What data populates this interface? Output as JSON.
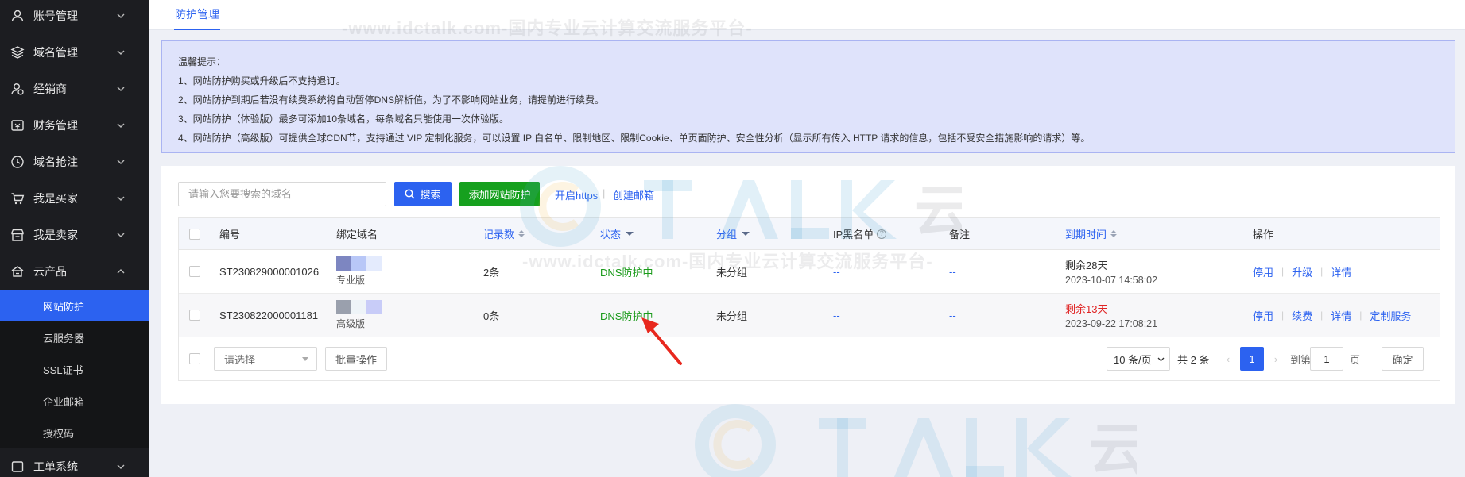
{
  "sidebar": {
    "items": [
      {
        "label": "账号管理",
        "icon": "user-icon"
      },
      {
        "label": "域名管理",
        "icon": "layers-icon"
      },
      {
        "label": "经销商",
        "icon": "dealer-icon"
      },
      {
        "label": "财务管理",
        "icon": "finance-icon"
      },
      {
        "label": "域名抢注",
        "icon": "clock-icon"
      },
      {
        "label": "我是买家",
        "icon": "cart-icon"
      },
      {
        "label": "我是卖家",
        "icon": "store-icon"
      },
      {
        "label": "云产品",
        "icon": "cloud-icon"
      }
    ],
    "sub_items": [
      {
        "label": "网站防护",
        "active": true
      },
      {
        "label": "云服务器"
      },
      {
        "label": "SSL证书"
      },
      {
        "label": "企业邮箱"
      },
      {
        "label": "授权码"
      }
    ],
    "last_item": {
      "label": "工单系统",
      "icon": "ticket-icon"
    }
  },
  "topbar": {
    "tab_label": "防护管理"
  },
  "notice": {
    "title": "温馨提示：",
    "lines": [
      "1、网站防护购买或升级后不支持退订。",
      "2、网站防护到期后若没有续费系统将自动暂停DNS解析值，为了不影响网站业务，请提前进行续费。",
      "3、网站防护（体验版）最多可添加10条域名，每条域名只能使用一次体验版。",
      "4、网站防护（高级版）可提供全球CDN节，支持通过 VIP 定制化服务，可以设置 IP 白名单、限制地区、限制Cookie、单页面防护、安全性分析（显示所有传入 HTTP 请求的信息，包括不受安全措施影响的请求）等。"
    ]
  },
  "toolbar": {
    "search_placeholder": "请输入您要搜索的域名",
    "search_label": "搜索",
    "add_label": "添加网站防护",
    "https_label": "开启https",
    "sep": "|",
    "mail_label": "创建邮箱"
  },
  "table": {
    "headers": {
      "id": "编号",
      "domain": "绑定域名",
      "records": "记录数",
      "status": "状态",
      "group": "分组",
      "ip_blacklist": "IP黑名单",
      "remark": "备注",
      "expiry": "到期时间",
      "ops": "操作"
    },
    "rows": [
      {
        "id": "ST230829000001026",
        "edition": "专业版",
        "records": "2条",
        "status": "DNS防护中",
        "group": "未分组",
        "ip_blacklist": "--",
        "remark": "--",
        "remaining": "剩余28天",
        "remaining_color": "#333333",
        "expiry_date": "2023-10-07 14:58:02",
        "ops": [
          "停用",
          "升级",
          "详情"
        ]
      },
      {
        "id": "ST230822000001181",
        "edition": "高级版",
        "records": "0条",
        "status": "DNS防护中",
        "group": "未分组",
        "ip_blacklist": "--",
        "remark": "--",
        "remaining": "剩余13天",
        "remaining_color": "#e02424",
        "expiry_date": "2023-09-22 17:08:21",
        "ops": [
          "停用",
          "续费",
          "详情",
          "定制服务"
        ]
      }
    ],
    "footer": {
      "select_placeholder": "请选择",
      "batch_label": "批量操作",
      "page_size": "10 条/页",
      "total": "共 2 条",
      "current_page": "1",
      "goto_label": "到第",
      "goto_value": "1",
      "page_unit": "页",
      "confirm_label": "确定"
    }
  },
  "watermark": {
    "url_text": "-www.idctalk.com-国内专业云计算交流服务平台-",
    "brand": "TALK 云说"
  }
}
